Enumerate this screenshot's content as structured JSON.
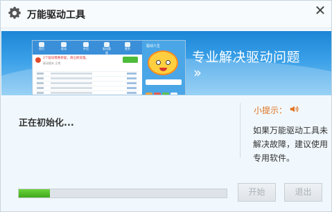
{
  "window": {
    "title": "万能驱动工具",
    "close_icon": "close-icon"
  },
  "banner": {
    "slogan": "专业解决驱动问题",
    "arrows": "››",
    "mini_app": {
      "side_title": "驱动人生",
      "alert_text": "2个驱动需要修复，请立即处理。",
      "sub_text": "驱动版本 正常",
      "nav": [
        "首页",
        "驱动",
        "外设",
        "驱动管理",
        "更多"
      ]
    }
  },
  "status": {
    "text": "正在初始化..."
  },
  "tip": {
    "title": "小提示：",
    "icon": "speaker-icon",
    "body": "如果万能驱动工具未解决故障，建议使用专用软件。"
  },
  "progress": {
    "value": 0.15,
    "color": "#4cbc2a"
  },
  "buttons": {
    "start": "开始",
    "exit": "退出"
  },
  "colors": {
    "accent": "#1c86d6",
    "tip": "#e0711e",
    "disabled_text": "#a9b1b8"
  }
}
